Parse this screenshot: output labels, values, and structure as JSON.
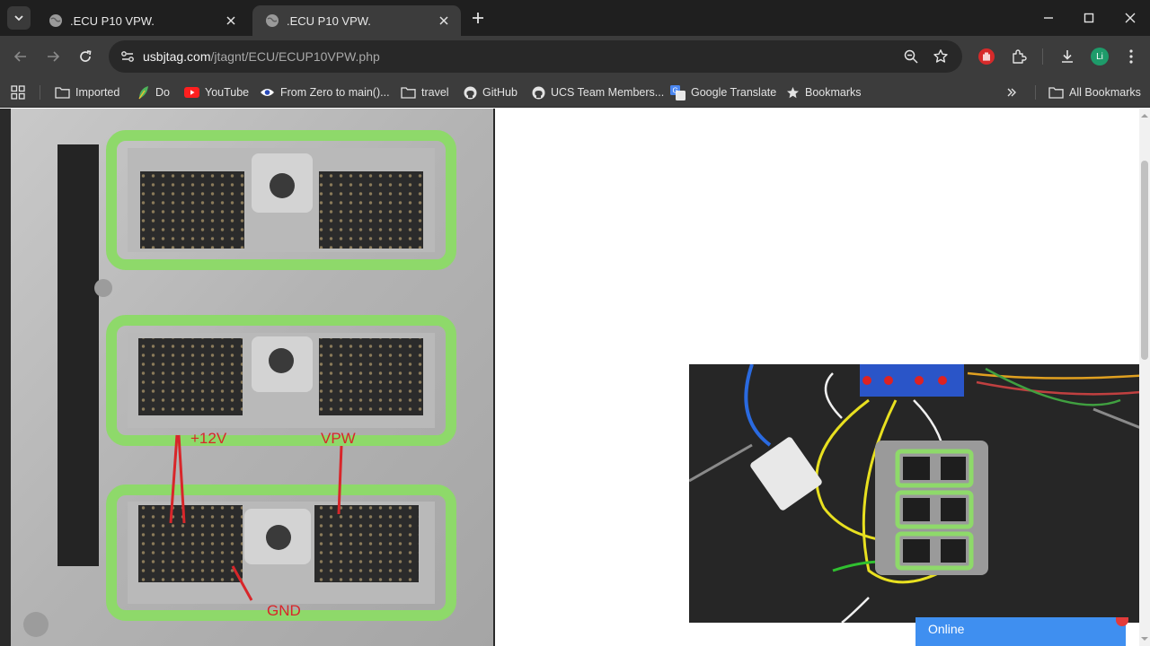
{
  "tabs": [
    {
      "title": ".ECU P10 VPW.",
      "active": false
    },
    {
      "title": ".ECU P10 VPW.",
      "active": true
    }
  ],
  "address_bar": {
    "host": "usbjtag.com",
    "path": "/jtagnt/ECU/ECUP10VPW.php"
  },
  "profile": {
    "initials": "Li",
    "color": "#1e9b6a"
  },
  "bookmarks": [
    {
      "label": "Imported",
      "icon": "folder-icon"
    },
    {
      "label": "Do",
      "icon": "leaf-icon"
    },
    {
      "label": "YouTube",
      "icon": "youtube-icon"
    },
    {
      "label": "From Zero to main()...",
      "icon": "eye-icon"
    },
    {
      "label": "travel",
      "icon": "folder-icon"
    },
    {
      "label": "GitHub",
      "icon": "github-icon"
    },
    {
      "label": "UCS Team Members...",
      "icon": "github-icon"
    },
    {
      "label": "Google Translate",
      "icon": "translate-icon"
    },
    {
      "label": "Bookmarks",
      "icon": "star-icon"
    }
  ],
  "all_bookmarks_label": "All Bookmarks",
  "ecu_image": {
    "labels": {
      "plus12v": "+12V",
      "vpw": "VPW",
      "gnd": "GND"
    },
    "connector_frame_color": "#8ed96a",
    "wire_label_color": "#d8262a"
  },
  "chat_widget": {
    "label": "Online",
    "color": "#3f8ff0"
  }
}
